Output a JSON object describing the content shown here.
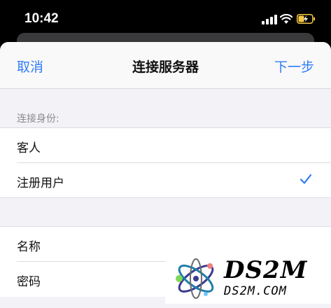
{
  "status_bar": {
    "time": "10:42"
  },
  "nav": {
    "cancel": "取消",
    "title": "连接服务器",
    "next": "下一步"
  },
  "identity": {
    "header": "连接身份:",
    "options": [
      {
        "label": "客人",
        "selected": false
      },
      {
        "label": "注册用户",
        "selected": true
      }
    ]
  },
  "fields": [
    {
      "label": "名称"
    },
    {
      "label": "密码"
    }
  ],
  "watermark": {
    "big": "DS2M",
    "small": "DS2M.COM"
  },
  "colors": {
    "accent": "#2f7cf6",
    "battery": "#f6c744"
  }
}
